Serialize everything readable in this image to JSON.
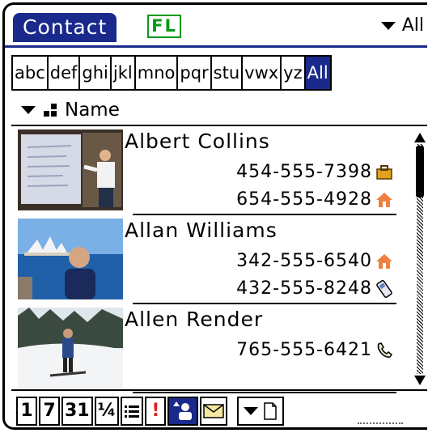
{
  "header": {
    "app_title": "Contact",
    "fl_badge": "FL",
    "category": "All"
  },
  "alpha_tabs": [
    "abc",
    "def",
    "ghi",
    "jkl",
    "mno",
    "pqr",
    "stu",
    "vwx",
    "yz",
    "All"
  ],
  "active_alpha_tab": "All",
  "sort": {
    "label": "Name"
  },
  "contacts": [
    {
      "name": "Albert Collins",
      "phones": [
        {
          "number": "454-555-7398",
          "type_icon": "work-briefcase-icon"
        },
        {
          "number": "654-555-4928",
          "type_icon": "home-icon"
        }
      ]
    },
    {
      "name": "Allan Williams",
      "phones": [
        {
          "number": "342-555-6540",
          "type_icon": "home-icon"
        },
        {
          "number": "432-555-8248",
          "type_icon": "mobile-phone-icon"
        }
      ]
    },
    {
      "name": "Allen Render",
      "phones": [
        {
          "number": "765-555-6421",
          "type_icon": "telephone-handset-icon"
        }
      ]
    }
  ],
  "toolbar": {
    "buttons": [
      {
        "label": "1",
        "name": "day-view"
      },
      {
        "label": "7",
        "name": "week-view"
      },
      {
        "label": "31",
        "name": "month-view"
      },
      {
        "label": "¼",
        "name": "agenda-view"
      },
      {
        "label": "☰",
        "name": "list-view"
      },
      {
        "label": "!",
        "name": "tasks-view"
      },
      {
        "label": "",
        "name": "contacts-view",
        "selected": true
      },
      {
        "label": "",
        "name": "mail-view"
      },
      {
        "label": "",
        "name": "new-menu"
      }
    ]
  },
  "colors": {
    "accent": "#1a2a8c",
    "fl_badge": "#0a9a1a",
    "work_icon": "#e0a020",
    "home_icon": "#f08040",
    "priority": "#e02020"
  }
}
